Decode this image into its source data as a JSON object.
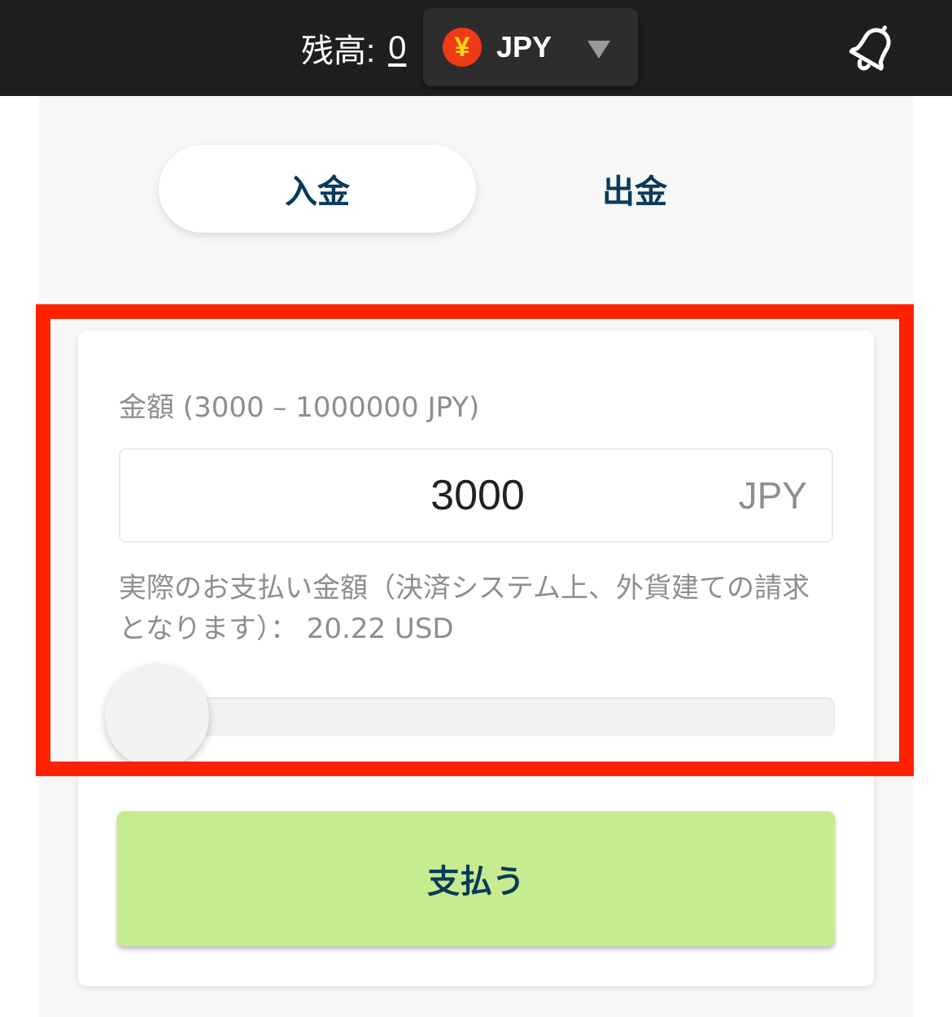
{
  "header": {
    "balance_label": "残高:",
    "balance_value": "0",
    "currency": {
      "code": "JPY",
      "symbol": "¥",
      "icon": "yen-coin-icon"
    },
    "notification_icon": "bell-icon"
  },
  "tabs": [
    {
      "label": "入金",
      "active": true
    },
    {
      "label": "出金",
      "active": false
    }
  ],
  "form": {
    "amount_label": "金額 (3000 – 1000000 JPY)",
    "amount_value": "3000",
    "amount_unit": "JPY",
    "actual_payment": "実際のお支払い金額（決済システム上、外貨建ての請求となります）： 20.22 USD",
    "slider_fraction": 0,
    "pay_button": "支払う"
  },
  "colors": {
    "header_bg": "#1f1f1f",
    "accent_red": "#ff2200",
    "pay_button_bg": "#c7ec8f",
    "tab_text": "#0b3a5a",
    "yen_icon_bg": "#ee3b16"
  }
}
